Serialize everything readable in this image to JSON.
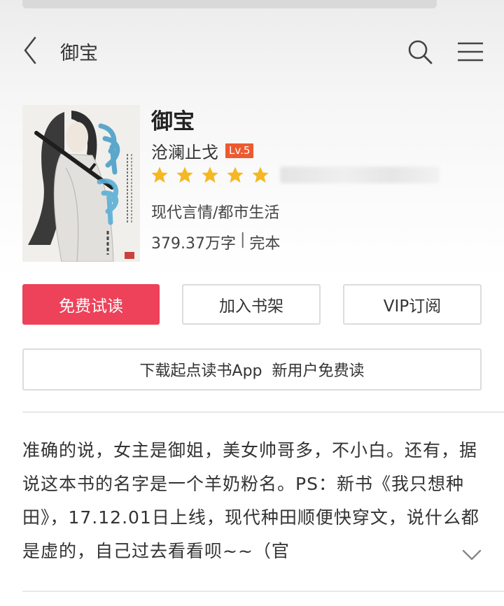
{
  "header": {
    "title": "御宝",
    "back_icon": "chevron-left-icon",
    "search_icon": "search-icon",
    "menu_icon": "menu-icon"
  },
  "book": {
    "title": "御宝",
    "author": "沧澜止戈",
    "author_level": "Lv.5",
    "rating_stars": 5,
    "category": "现代言情/都市生活",
    "word_count": "379.37万字",
    "status": "完本",
    "meta_separator": "|"
  },
  "actions": {
    "read_free": "免费试读",
    "add_shelf": "加入书架",
    "vip_subscribe": "VIP订阅",
    "download_app": "下载起点读书App  新用户免费读"
  },
  "intro": {
    "text": "准确的说，女主是御姐，美女帅哥多，不小白。还有，据说这本书的名字是一个羊奶粉名。PS：新书《我只想种田》，17.12.01日上线，现代种田顺便快穿文，说什么都是虚的，自己过去看看呗~~（官"
  },
  "colors": {
    "primary_red": "#ed4259",
    "level_badge": "#ee5a2f",
    "star": "#f5b823"
  }
}
